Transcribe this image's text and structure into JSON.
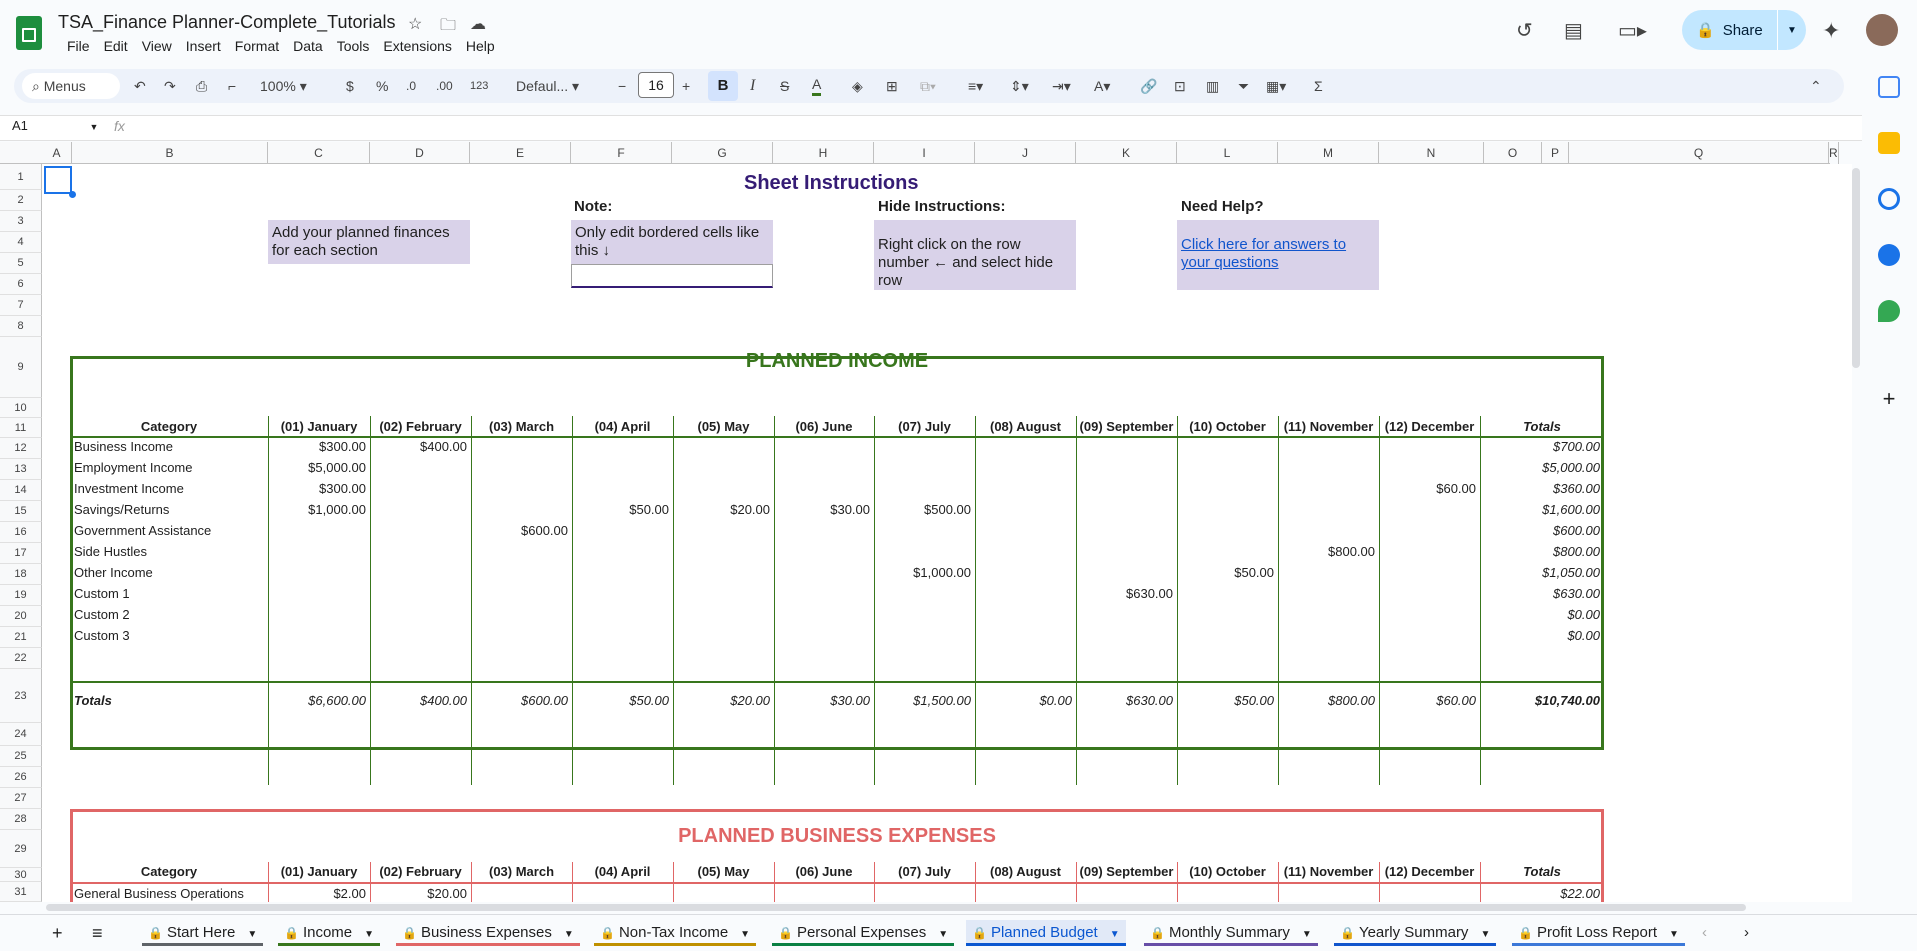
{
  "app": {
    "title": "TSA_Finance Planner-Complete_Tutorials",
    "menus": [
      "File",
      "Edit",
      "View",
      "Insert",
      "Format",
      "Data",
      "Tools",
      "Extensions",
      "Help"
    ],
    "share_label": "Share"
  },
  "toolbar": {
    "search": "Menus",
    "zoom": "100%",
    "currency": "$",
    "percent": "%",
    "dec_dec": ".0",
    "inc_dec": ".00",
    "format_num": "123",
    "font": "Defaul...",
    "font_size": "16",
    "bold": "B",
    "italic": "I",
    "text_color": "A"
  },
  "formula": {
    "namebox": "A1",
    "fx": "fx"
  },
  "columns": [
    "A",
    "B",
    "C",
    "D",
    "E",
    "F",
    "G",
    "H",
    "I",
    "J",
    "K",
    "L",
    "M",
    "N",
    "O",
    "P",
    "Q",
    "R"
  ],
  "rows": [
    "1",
    "2",
    "3",
    "4",
    "5",
    "6",
    "7",
    "8",
    "9",
    "10",
    "11",
    "12",
    "13",
    "14",
    "15",
    "16",
    "17",
    "18",
    "19",
    "20",
    "21",
    "22",
    "23",
    "24",
    "25",
    "26",
    "27",
    "28",
    "29",
    "30",
    "31"
  ],
  "instructions": {
    "heading": "Sheet Instructions",
    "note_title": "Note:",
    "note_text": "Only edit bordered cells like this  ↓",
    "hide_title": "Hide Instructions:",
    "hide_text": "Right click on the row number ← and select hide row",
    "help_title": "Need Help?",
    "help_link": "Click here for answers to your questions",
    "add_text": "Add your planned finances for each section"
  },
  "income": {
    "title": "PLANNED INCOME",
    "header": [
      "Category",
      "(01) January",
      "(02) February",
      "(03) March",
      "(04) April",
      "(05) May",
      "(06) June",
      "(07) July",
      "(08) August",
      "(09) September",
      "(10) October",
      "(11) November",
      "(12) December",
      "Totals"
    ],
    "rows": [
      [
        "Business Income",
        "$300.00",
        "$400.00",
        "",
        "",
        "",
        "",
        "",
        "",
        "",
        "",
        "",
        "",
        "$700.00"
      ],
      [
        "Employment Income",
        "$5,000.00",
        "",
        "",
        "",
        "",
        "",
        "",
        "",
        "",
        "",
        "",
        "",
        "$5,000.00"
      ],
      [
        "Investment Income",
        "$300.00",
        "",
        "",
        "",
        "",
        "",
        "",
        "",
        "",
        "",
        "",
        "$60.00",
        "$360.00"
      ],
      [
        "Savings/Returns",
        "$1,000.00",
        "",
        "",
        "$50.00",
        "$20.00",
        "$30.00",
        "$500.00",
        "",
        "",
        "",
        "",
        "",
        "$1,600.00"
      ],
      [
        "Government Assistance",
        "",
        "",
        "$600.00",
        "",
        "",
        "",
        "",
        "",
        "",
        "",
        "",
        "",
        "$600.00"
      ],
      [
        "Side Hustles",
        "",
        "",
        "",
        "",
        "",
        "",
        "",
        "",
        "",
        "",
        "$800.00",
        "",
        "$800.00"
      ],
      [
        "Other Income",
        "",
        "",
        "",
        "",
        "",
        "",
        "$1,000.00",
        "",
        "",
        "$50.00",
        "",
        "",
        "$1,050.00"
      ],
      [
        "Custom 1",
        "",
        "",
        "",
        "",
        "",
        "",
        "",
        "",
        "$630.00",
        "",
        "",
        "",
        "$630.00"
      ],
      [
        "Custom 2",
        "",
        "",
        "",
        "",
        "",
        "",
        "",
        "",
        "",
        "",
        "",
        "",
        "$0.00"
      ],
      [
        "Custom 3",
        "",
        "",
        "",
        "",
        "",
        "",
        "",
        "",
        "",
        "",
        "",
        "",
        "$0.00"
      ]
    ],
    "totals": [
      "Totals",
      "$6,600.00",
      "$400.00",
      "$600.00",
      "$50.00",
      "$20.00",
      "$30.00",
      "$1,500.00",
      "$0.00",
      "$630.00",
      "$50.00",
      "$800.00",
      "$60.00",
      "$10,740.00"
    ]
  },
  "business": {
    "title": "PLANNED BUSINESS EXPENSES",
    "header": [
      "Category",
      "(01) January",
      "(02) February",
      "(03) March",
      "(04) April",
      "(05) May",
      "(06) June",
      "(07) July",
      "(08) August",
      "(09) September",
      "(10) October",
      "(11) November",
      "(12) December",
      "Totals"
    ],
    "rows": [
      [
        "General Business Operations",
        "$2.00",
        "$20.00",
        "",
        "",
        "",
        "",
        "",
        "",
        "",
        "",
        "",
        "",
        "$22.00"
      ]
    ]
  },
  "tabs": [
    "Start Here",
    "Income",
    "Business Expenses",
    "Non-Tax Income",
    "Personal Expenses",
    "Planned Budget",
    "Monthly Summary",
    "Yearly Summary",
    "Profit Loss Report"
  ],
  "colors": {
    "income_green": "#38761d",
    "business_red": "#e06666",
    "purple": "#351c75",
    "note_bg": "#d9d2e9",
    "active_tab": "#0b57d0"
  }
}
